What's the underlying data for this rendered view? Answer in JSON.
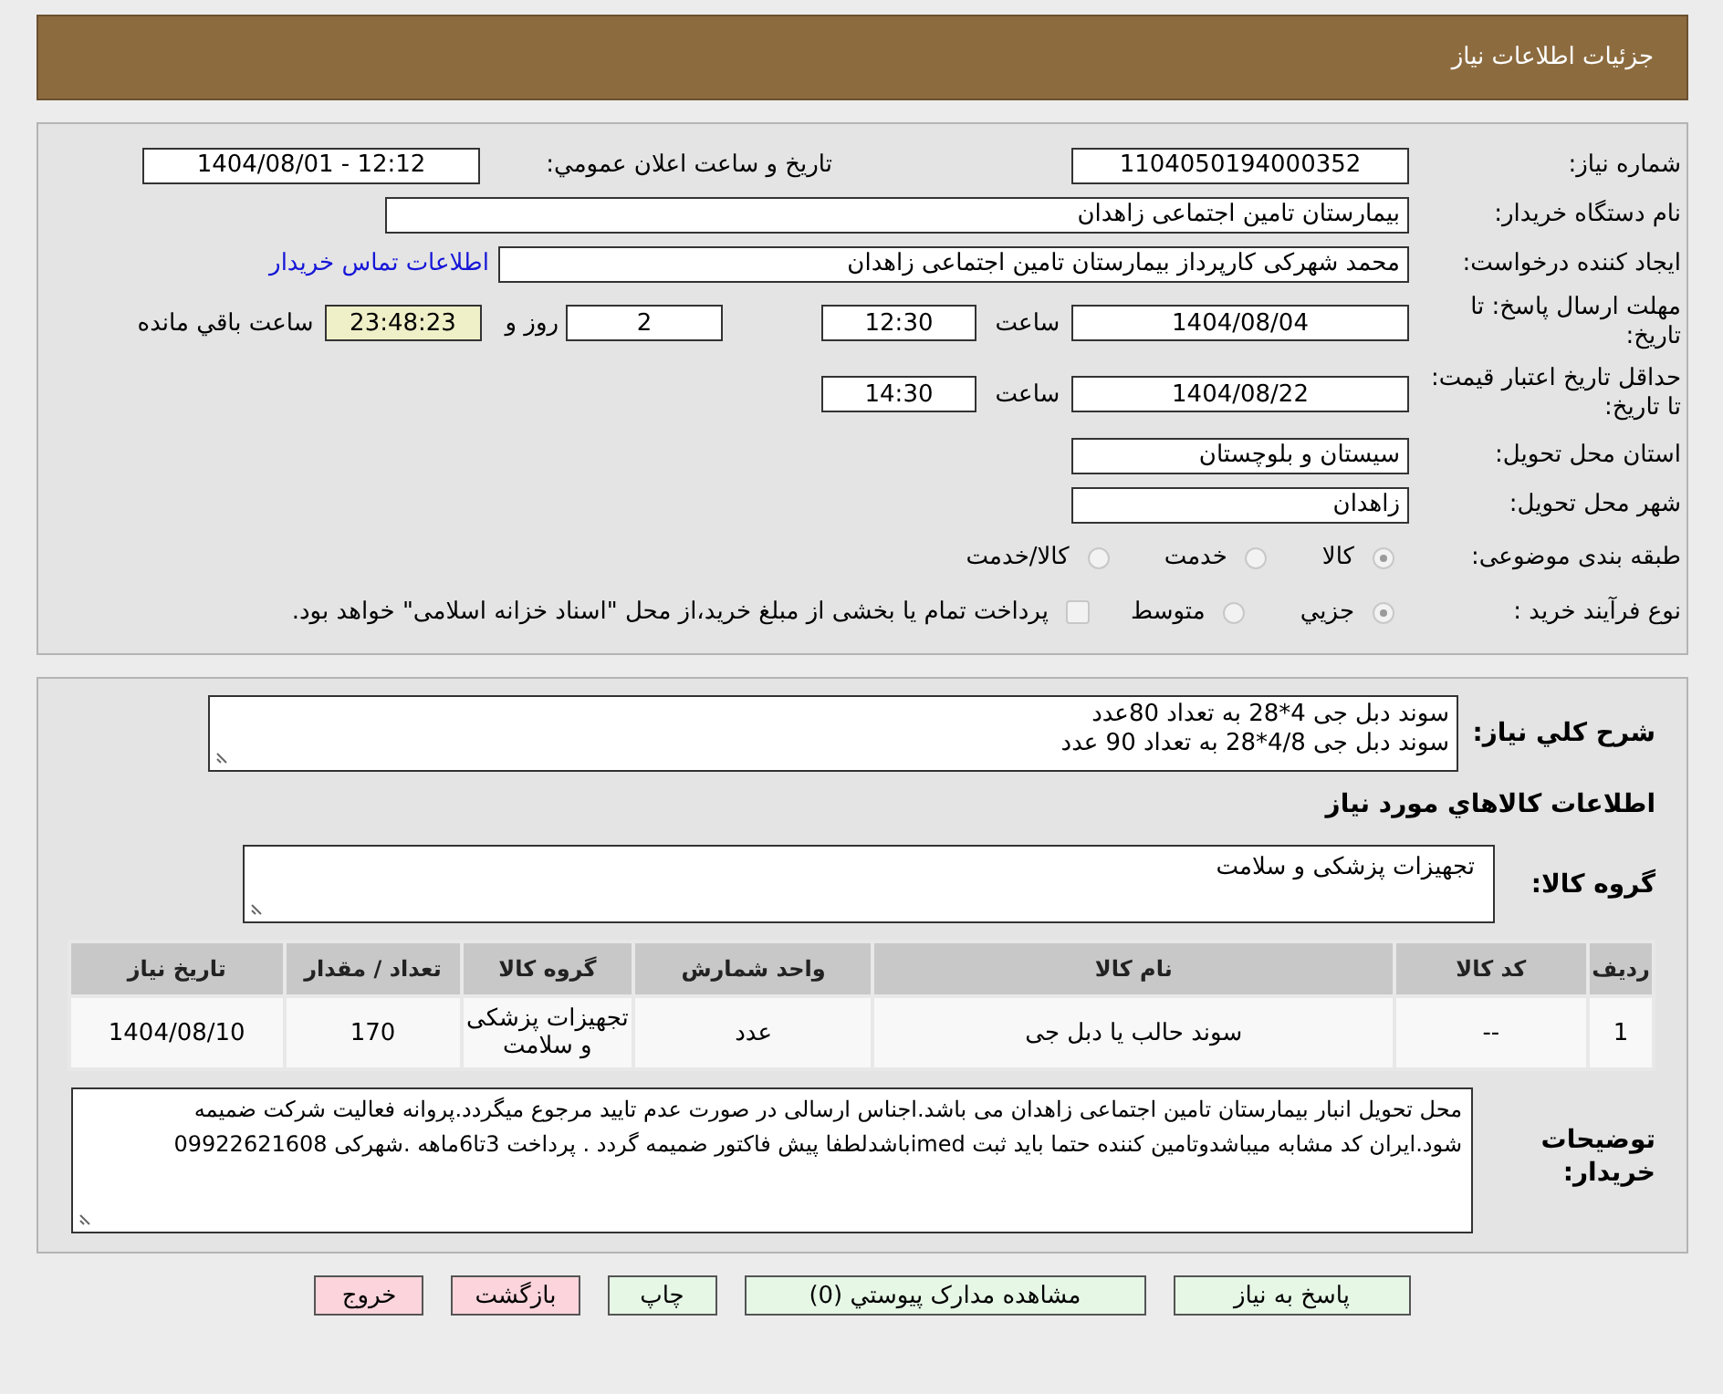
{
  "header": {
    "title": "جزئیات اطلاعات نیاز"
  },
  "details": {
    "rows": [
      {
        "label": "شماره نیاز:",
        "items": [
          {
            "kind": "field",
            "value": "1104050194000352"
          },
          {
            "kind": "text",
            "text": "تاریخ و ساعت اعلان عمومي:"
          },
          {
            "kind": "field",
            "value": "1404/08/01 - 12:12"
          }
        ]
      },
      {
        "label": "نام دستگاه خریدار:",
        "items": [
          {
            "kind": "field",
            "value": "بیمارستان تامین اجتماعی زاهدان"
          }
        ]
      },
      {
        "label": "ایجاد کننده درخواست:",
        "items": [
          {
            "kind": "field",
            "value": "محمد شهرکی کارپرداز بیمارستان تامین اجتماعی زاهدان"
          },
          {
            "kind": "link",
            "text": "اطلاعات تماس خریدار"
          }
        ]
      },
      {
        "label": "مهلت ارسال پاسخ: تا تاریخ:",
        "items": [
          {
            "kind": "field",
            "value": "1404/08/04"
          },
          {
            "kind": "text",
            "text": "ساعت"
          },
          {
            "kind": "field",
            "value": "12:30"
          },
          {
            "kind": "field",
            "value": "2"
          },
          {
            "kind": "text",
            "text": "روز و"
          },
          {
            "kind": "countdown",
            "value": "23:48:23"
          },
          {
            "kind": "text",
            "text": "ساعت باقي مانده"
          }
        ]
      },
      {
        "label": "حداقل تاریخ اعتبار قیمت: تا تاریخ:",
        "items": [
          {
            "kind": "field",
            "value": "1404/08/22"
          },
          {
            "kind": "text",
            "text": "ساعت"
          },
          {
            "kind": "field",
            "value": "14:30"
          }
        ]
      },
      {
        "label": "استان محل تحویل:",
        "items": [
          {
            "kind": "field",
            "value": "سیستان و بلوچستان"
          }
        ]
      },
      {
        "label": "شهر محل تحویل:",
        "items": [
          {
            "kind": "field",
            "value": "زاهدان"
          }
        ]
      },
      {
        "label": "طبقه بندی موضوعی:",
        "items": [
          {
            "kind": "radio",
            "label": "کالا",
            "selected": true,
            "disabled": true
          },
          {
            "kind": "radio",
            "label": "خدمت",
            "selected": false,
            "disabled": true
          },
          {
            "kind": "radio",
            "label": "کالا/خدمت",
            "selected": false,
            "disabled": true
          }
        ]
      },
      {
        "label": "نوع فرآیند خرید :",
        "items": [
          {
            "kind": "radio",
            "label": "جزيي",
            "selected": true,
            "disabled": true
          },
          {
            "kind": "radio",
            "label": "متوسط",
            "selected": false,
            "disabled": true
          },
          {
            "kind": "checkbox",
            "label": "پرداخت تمام یا بخشی از مبلغ خرید،از محل \"اسناد خزانه اسلامی\" خواهد بود.",
            "checked": false,
            "disabled": true
          }
        ]
      }
    ]
  },
  "need": {
    "summary_label": "شرح کلي نیاز:",
    "summary_lines": [
      "سوند دبل جی 4*28 به تعداد 80عدد",
      "سوند دبل جی 4/8*28 به تعداد 90 عدد"
    ],
    "items_heading": "اطلاعات کالاهاي مورد نیاز",
    "group_label": "گروه کالا:",
    "group_value": "تجهیزات پزشکی و سلامت",
    "table": {
      "columns": [
        "ردیف",
        "کد کالا",
        "نام کالا",
        "واحد شمارش",
        "گروه کالا",
        "تعداد / مقدار",
        "تاریخ نیاز"
      ],
      "rows": [
        [
          "1",
          "--",
          "سوند حالب یا دبل جی",
          "عدد",
          "تجهیزات پزشکی و سلامت",
          "170",
          "1404/08/10"
        ]
      ]
    },
    "notes_label": "توضیحات خریدار:",
    "notes": "محل تحویل انبار بیمارستان تامین اجتماعی زاهدان می باشد.اجناس ارسالی در صورت عدم تایید مرجوع میگردد.پروانه فعالیت شرکت ضمیمه شود.ایران کد مشابه میباشدوتامین کننده حتما باید ثبت imedباشدلطفا پیش فاکتور ضمیمه گردد . پرداخت 3تا6ماهه  .شهرکی 09922621608"
  },
  "buttons": [
    {
      "label": "پاسخ به نیاز",
      "kind": "primary"
    },
    {
      "label": "مشاهده مدارک پیوستي (0)",
      "kind": "primary"
    },
    {
      "label": "چاپ",
      "kind": "primary"
    },
    {
      "label": "بازگشت",
      "kind": "danger"
    },
    {
      "label": "خروج",
      "kind": "danger"
    }
  ]
}
